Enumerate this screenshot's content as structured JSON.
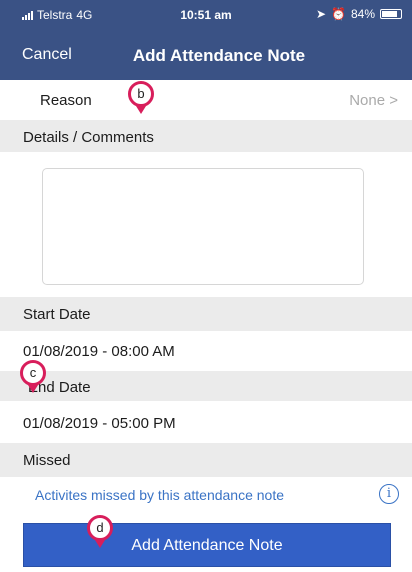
{
  "status_bar": {
    "carrier": "Telstra",
    "network": "4G",
    "time": "10:51 am",
    "battery": "84%",
    "battery_level": 0.84
  },
  "nav": {
    "cancel": "Cancel",
    "title": "Add Attendance Note"
  },
  "reason": {
    "label": "Reason",
    "value": "None >"
  },
  "details": {
    "header": "Details / Comments",
    "value": ""
  },
  "start": {
    "header": "Start Date",
    "value": "01/08/2019 - 08:00 AM"
  },
  "end": {
    "header": "End Date",
    "value": "01/08/2019 - 05:00 PM"
  },
  "missed": {
    "header": "Missed",
    "link": "Activites missed by this attendance note",
    "info_icon": "i"
  },
  "action": {
    "button": "Add Attendance Note"
  },
  "markers": {
    "b": "b",
    "c": "c",
    "d": "d"
  },
  "colors": {
    "header_bg": "#3a5285",
    "button_bg": "#3360c6",
    "link": "#3a73c5",
    "marker": "#d81e5b",
    "section_bg": "#ebebeb"
  }
}
